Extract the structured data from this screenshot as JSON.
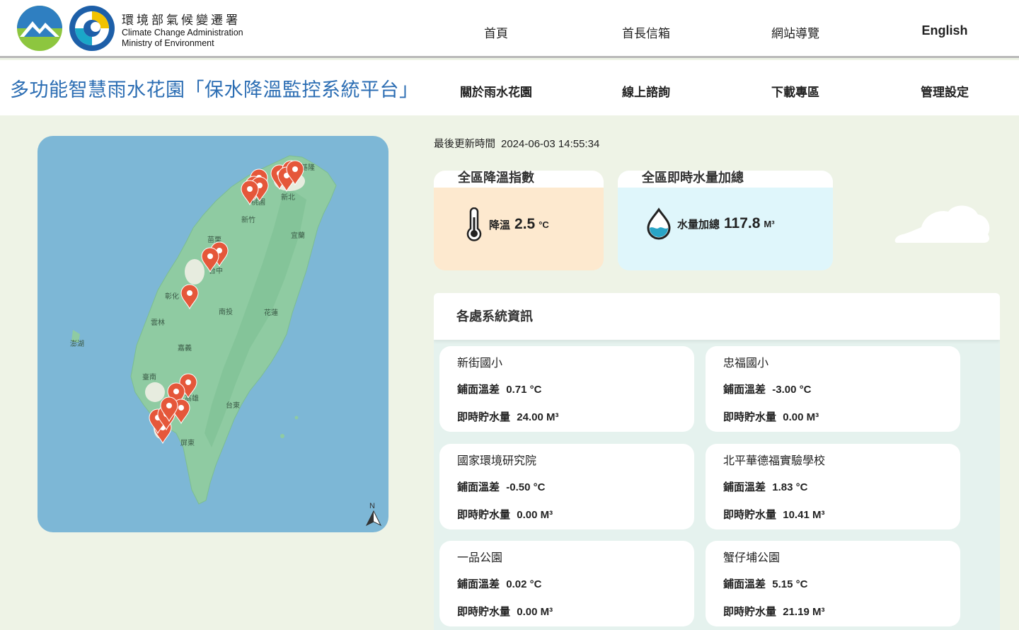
{
  "logo": {
    "zh": "環境部氣候變遷署",
    "en1": "Climate Change Administration",
    "en2": "Ministry of Environment"
  },
  "topnav": [
    "首頁",
    "首長信箱",
    "網站導覽",
    "English"
  ],
  "site_title": "多功能智慧雨水花園「保水降溫監控系統平台」",
  "subnav": [
    "關於雨水花園",
    "線上諮詢",
    "下載專區",
    "管理設定"
  ],
  "map": {
    "labels": [
      "基隆",
      "臺北",
      "新北",
      "桃園",
      "新竹",
      "宜蘭",
      "苗栗",
      "台中",
      "彰化",
      "南投",
      "花蓮",
      "雲林",
      "澎湖",
      "嘉義",
      "臺南",
      "高雄",
      "台東",
      "屏東"
    ],
    "north": "N",
    "colors": {
      "sea": "#7db7d6",
      "land": "#8fcba2",
      "pin": "#e5573a"
    }
  },
  "update": {
    "label": "最後更新時間",
    "value": "2024-06-03 14:55:34"
  },
  "summary": {
    "temp": {
      "title": "全區降溫指數",
      "label": "降溫",
      "value": "2.5",
      "unit": "°C"
    },
    "water": {
      "title": "全區即時水量加總",
      "label": "水量加總",
      "value": "117.8",
      "unit": "M³"
    }
  },
  "sites_title": "各處系統資訊",
  "sites": [
    {
      "name": "新街國小",
      "temp_label": "鋪面溫差",
      "temp": "0.71 °C",
      "water_label": "即時貯水量",
      "water": "24.00 M³"
    },
    {
      "name": "忠福國小",
      "temp_label": "鋪面溫差",
      "temp": "-3.00 °C",
      "water_label": "即時貯水量",
      "water": "0.00 M³"
    },
    {
      "name": "國家環境研究院",
      "temp_label": "鋪面溫差",
      "temp": "-0.50 °C",
      "water_label": "即時貯水量",
      "water": "0.00 M³"
    },
    {
      "name": "北平華德福實驗學校",
      "temp_label": "鋪面溫差",
      "temp": "1.83 °C",
      "water_label": "即時貯水量",
      "water": "10.41 M³"
    },
    {
      "name": "一品公園",
      "temp_label": "鋪面溫差",
      "temp": "0.02 °C",
      "water_label": "即時貯水量",
      "water": "0.00 M³"
    },
    {
      "name": "蟹仔埔公園",
      "temp_label": "鋪面溫差",
      "temp": "5.15 °C",
      "water_label": "即時貯水量",
      "water": "21.19 M³"
    }
  ]
}
